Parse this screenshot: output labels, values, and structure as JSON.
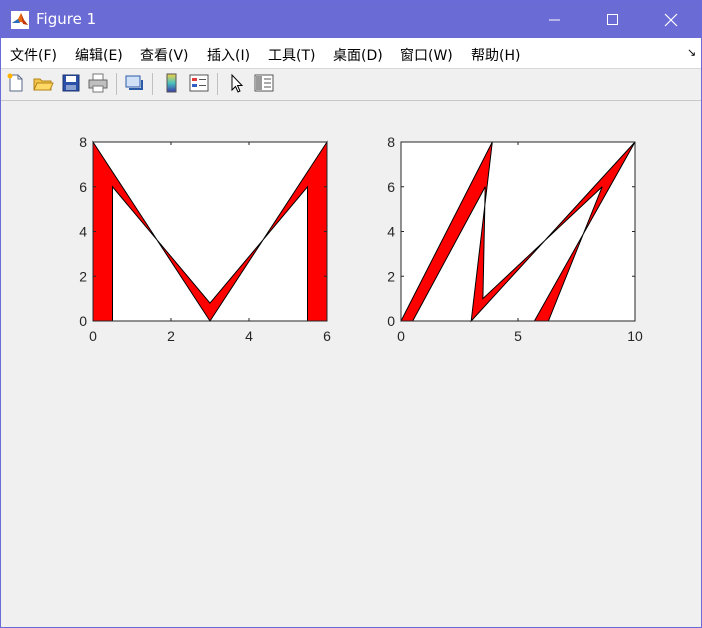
{
  "window": {
    "title": "Figure 1"
  },
  "menu": {
    "items": [
      {
        "label": "文件(F)"
      },
      {
        "label": "编辑(E)"
      },
      {
        "label": "查看(V)"
      },
      {
        "label": "插入(I)"
      },
      {
        "label": "工具(T)"
      },
      {
        "label": "桌面(D)"
      },
      {
        "label": "窗口(W)"
      },
      {
        "label": "帮助(H)"
      }
    ]
  },
  "toolbar": {
    "icons": [
      "new-figure-icon",
      "open-file-icon",
      "save-icon",
      "print-icon",
      "link-plot-icon",
      "colorbar-icon",
      "legend-icon",
      "edit-plot-icon",
      "property-inspector-icon"
    ]
  },
  "colors": {
    "titlebar": "#6b6bd6",
    "fill": "#ff0000",
    "edge": "#000000"
  },
  "chart_data": [
    {
      "type": "area",
      "shape": "filled polygon (letter M)",
      "xlim": [
        0,
        6
      ],
      "ylim": [
        0,
        8
      ],
      "xticks": [
        "0",
        "2",
        "4",
        "6"
      ],
      "yticks": [
        "0",
        "2",
        "4",
        "6",
        "8"
      ],
      "polygon": {
        "x": [
          0,
          0,
          3,
          6,
          6,
          5.5,
          5.5,
          3,
          0.5,
          0.5
        ],
        "y": [
          0,
          8,
          0,
          8,
          0,
          0,
          6,
          0.8,
          6,
          0
        ]
      }
    },
    {
      "type": "area",
      "shape": "filled polygon (slanted M)",
      "xlim": [
        0,
        10
      ],
      "ylim": [
        0,
        8
      ],
      "xticks": [
        "0",
        "5",
        "10"
      ],
      "yticks": [
        "0",
        "2",
        "4",
        "6",
        "8"
      ],
      "polygon": {
        "x": [
          0,
          3.9,
          3.0,
          10,
          5.7,
          6.3,
          8.6,
          3.5,
          3.6,
          0.5
        ],
        "y": [
          0,
          8,
          0,
          8,
          0,
          0,
          6,
          1,
          6,
          0
        ]
      }
    }
  ]
}
